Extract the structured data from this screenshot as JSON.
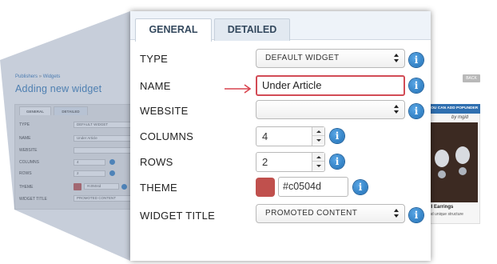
{
  "background_page": {
    "breadcrumb": [
      "Publishers",
      "Widgets"
    ],
    "breadcrumb_sep": "»",
    "title": "Adding new widget",
    "back_label": "BACK",
    "tabs": [
      "GENERAL",
      "DETAILED"
    ],
    "rows": [
      {
        "label": "TYPE",
        "value": "DEFAULT WIDGET"
      },
      {
        "label": "NAME",
        "value": "Under Article"
      },
      {
        "label": "WEBSITE",
        "value": ""
      },
      {
        "label": "COLUMNS",
        "value": "4"
      },
      {
        "label": "ROWS",
        "value": "2"
      },
      {
        "label": "THEME",
        "value": "#c0504d"
      },
      {
        "label": "WIDGET TITLE",
        "value": "PROMOTED CONTENT"
      }
    ],
    "ad": {
      "header": "YOU CAN ADD POPUNDER",
      "brand": "by mgid",
      "title": "ll Earrings",
      "text": "ind unique structure"
    }
  },
  "tabs": {
    "general": "GENERAL",
    "detailed": "DETAILED"
  },
  "form": {
    "type": {
      "label": "TYPE",
      "value": "DEFAULT WIDGET"
    },
    "name": {
      "label": "NAME",
      "value": "Under Article"
    },
    "website": {
      "label": "WEBSITE",
      "value": ""
    },
    "columns": {
      "label": "COLUMNS",
      "value": "4"
    },
    "rows": {
      "label": "ROWS",
      "value": "2"
    },
    "theme": {
      "label": "THEME",
      "value": "#c0504d"
    },
    "widget_title": {
      "label": "WIDGET TITLE",
      "value": "PROMOTED CONTENT"
    }
  },
  "icons": {
    "info": "info-icon",
    "arrow": "arrow-right-icon",
    "select_caret": "up-down-caret-icon"
  },
  "colors": {
    "theme": "#c0504d",
    "highlight_border": "#d24b55",
    "arrow": "#d9434e",
    "info": "#1f6fb5",
    "link": "#2f78b8",
    "tab_bar": "#eef3f9"
  }
}
